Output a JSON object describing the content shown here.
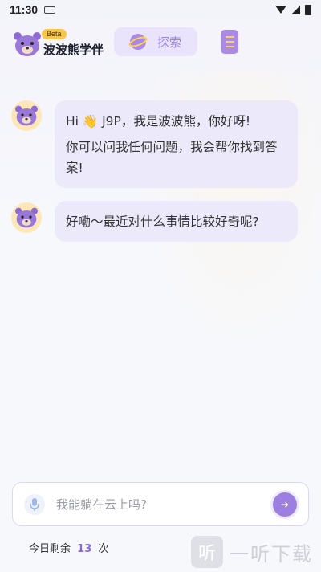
{
  "status_bar": {
    "time": "11:30"
  },
  "header": {
    "beta": "Beta",
    "app_name": "波波熊学伴",
    "explore_label": "探索"
  },
  "messages": [
    {
      "lines": [
        "Hi 👋 J9P，我是波波熊，你好呀!",
        "你可以问我任何问题，我会帮你找到答案!"
      ]
    },
    {
      "lines": [
        "好嘞～最近对什么事情比较好奇呢?"
      ]
    }
  ],
  "input": {
    "placeholder": "我能躺在云上吗?"
  },
  "quota": {
    "prefix": "今日剩余",
    "count": "13",
    "suffix": "次"
  },
  "watermark": {
    "logo": "听",
    "text": "一听下载"
  },
  "colors": {
    "accent": "#9c7fe0",
    "bubble": "#ece9fa",
    "beta": "#f7c64b"
  }
}
